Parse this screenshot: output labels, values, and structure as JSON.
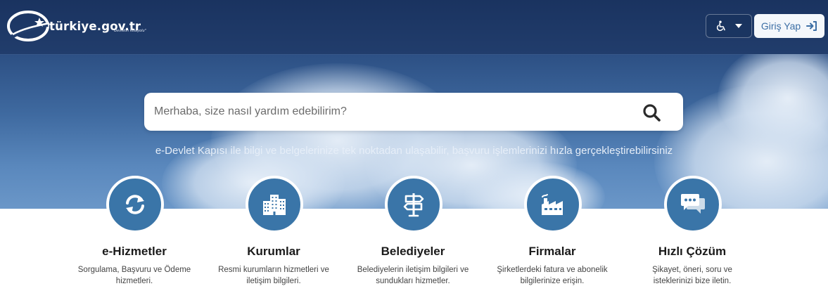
{
  "header": {
    "logo_text": "türkiye.gov.tr",
    "logo_subtext": "\"Devletin Kısayolu\"",
    "login_label": "Giriş Yap"
  },
  "search": {
    "placeholder": "Merhaba, size nasıl yardım edebilirim?"
  },
  "tagline": "e-Devlet Kapısı ile bilgi ve belgelerinize tek noktadan ulaşabilir, başvuru işlemlerinizi hızla gerçekleştirebilirsiniz",
  "categories": [
    {
      "title": "e-Hizmetler",
      "desc_line1": "Sorgulama, Başvuru ve Ödeme",
      "desc_line2": "hizmetleri.",
      "icon": "refresh-icon"
    },
    {
      "title": "Kurumlar",
      "desc_line1": "Resmi kurumların hizmetleri ve",
      "desc_line2": "iletişim bilgileri.",
      "icon": "building-icon"
    },
    {
      "title": "Belediyeler",
      "desc_line1": "Belediyelerin iletişim bilgileri ve",
      "desc_line2": "sundukları hizmetler.",
      "icon": "signpost-icon"
    },
    {
      "title": "Firmalar",
      "desc_line1": "Şirketlerdeki fatura ve abonelik",
      "desc_line2": "bilgilerinize erişin.",
      "icon": "factory-icon"
    },
    {
      "title": "Hızlı Çözüm",
      "desc_line1": "Şikayet, öneri, soru ve",
      "desc_line2": "isteklerinizi bize iletin.",
      "icon": "chat-icon"
    }
  ],
  "colors": {
    "accent": "#3a75a8",
    "header_bg": "#1a3360",
    "login_text": "#3d6fa5"
  }
}
